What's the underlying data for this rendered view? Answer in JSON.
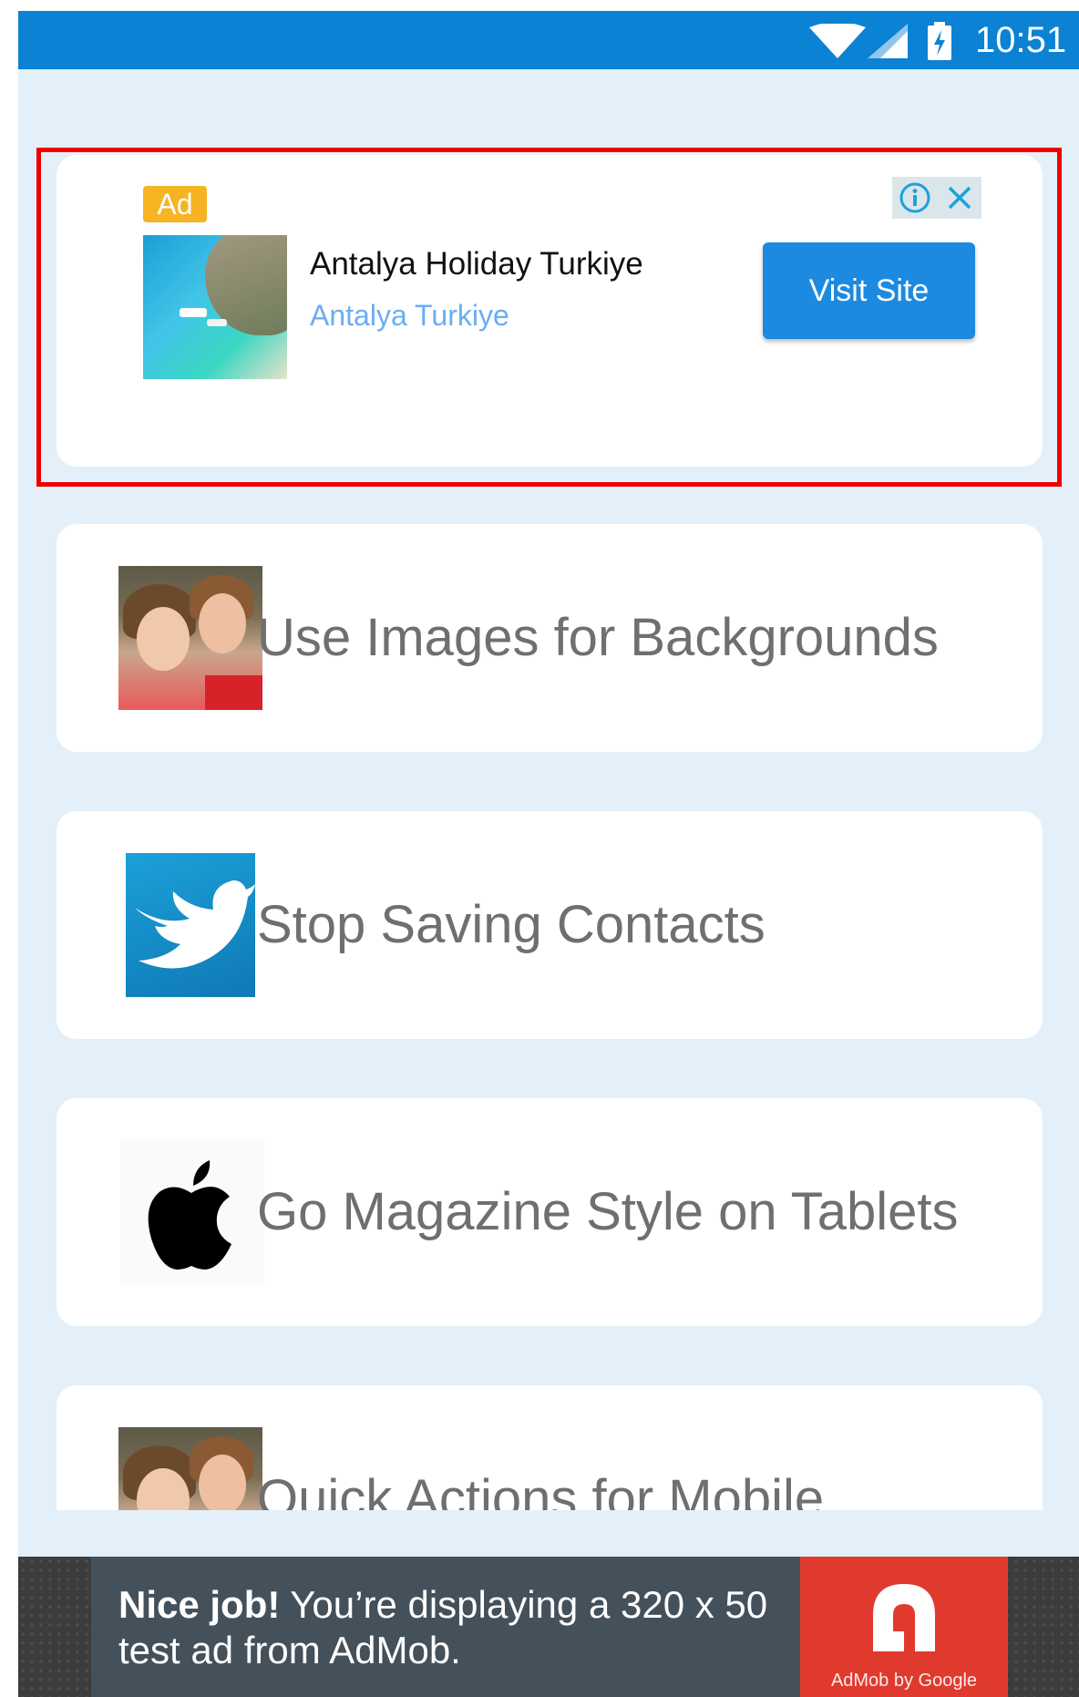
{
  "status_bar": {
    "time": "10:51",
    "icons": [
      "wifi-icon",
      "signal-icon",
      "battery-charging-icon"
    ]
  },
  "native_ad": {
    "badge": "Ad",
    "headline": "Antalya Holiday Turkiye",
    "advertiser": "Antalya Turkiye",
    "cta_label": "Visit Site",
    "controls": [
      "info-icon",
      "close-icon"
    ],
    "highlight_color": "#ee0000"
  },
  "list": {
    "items": [
      {
        "title": "Use Images for Backgrounds",
        "thumbnail": "girls-photo"
      },
      {
        "title": "Stop Saving Contacts",
        "thumbnail": "twitter-logo"
      },
      {
        "title": "Go Magazine Style on Tablets",
        "thumbnail": "apple-logo"
      },
      {
        "title": "Quick Actions for Mobile",
        "thumbnail": "girls-photo"
      }
    ]
  },
  "banner_ad": {
    "bold": "Nice job!",
    "text": " You’re displaying a 320 x 50 test ad from AdMob.",
    "logo_caption": "AdMob by Google"
  },
  "colors": {
    "status_bar": "#0b82d4",
    "background": "#e3f0f9",
    "cta": "#1c8ae0",
    "ad_badge": "#f6b422",
    "admob_red": "#e03a2e"
  }
}
